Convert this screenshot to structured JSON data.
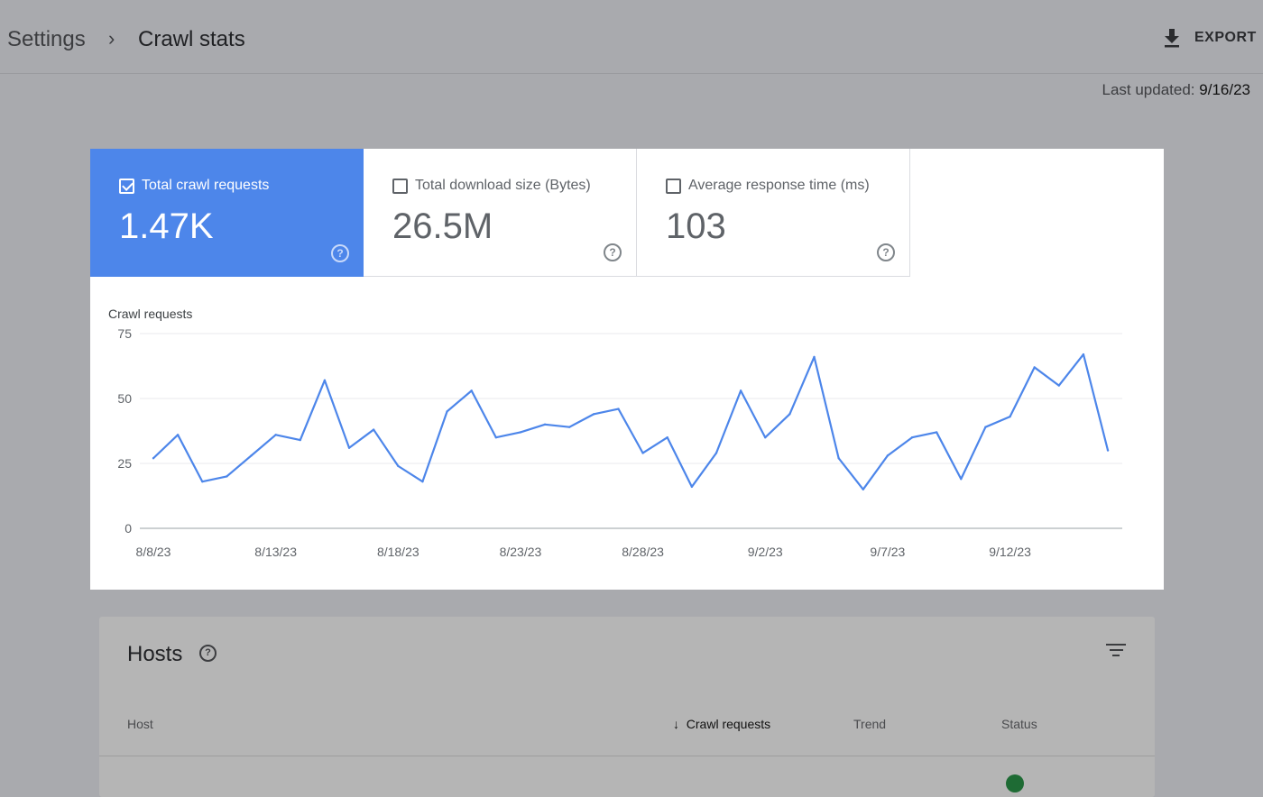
{
  "header": {
    "breadcrumb_parent": "Settings",
    "breadcrumb_separator": "›",
    "title": "Crawl stats",
    "export_label": "EXPORT",
    "export_icon": "download-icon"
  },
  "last_updated": {
    "label": "Last updated:",
    "value": "9/16/23"
  },
  "metrics": [
    {
      "label": "Total crawl requests",
      "value": "1.47K",
      "checked": true
    },
    {
      "label": "Total download size (Bytes)",
      "value": "26.5M",
      "checked": false
    },
    {
      "label": "Average response time (ms)",
      "value": "103",
      "checked": false
    }
  ],
  "colors": {
    "accent": "#4d86ea",
    "line": "#4d86ea",
    "status_ok": "#1e6b34"
  },
  "chart_data": {
    "type": "line",
    "title": "Crawl requests",
    "ylim": [
      0,
      75
    ],
    "yticks": [
      0,
      25,
      50,
      75
    ],
    "xtick_labels": [
      "8/8/23",
      "8/13/23",
      "8/18/23",
      "8/23/23",
      "8/28/23",
      "9/2/23",
      "9/7/23",
      "9/12/23"
    ],
    "grid": true,
    "x_start": "8/8/23",
    "x_end": "9/16/23",
    "series": [
      {
        "values": [
          27,
          36,
          18,
          20,
          28,
          36,
          34,
          57,
          31,
          38,
          24,
          18,
          45,
          53,
          35,
          37,
          40,
          39,
          44,
          46,
          29,
          35,
          16,
          29,
          53,
          35,
          44,
          66,
          27,
          15,
          28,
          35,
          37,
          19,
          39,
          43,
          62,
          55,
          67,
          30
        ]
      }
    ]
  },
  "hosts": {
    "title": "Hosts",
    "columns": {
      "host": "Host",
      "crawl_requests": "Crawl requests",
      "trend": "Trend",
      "status": "Status"
    },
    "sort_icon": "arrow-down-icon"
  }
}
